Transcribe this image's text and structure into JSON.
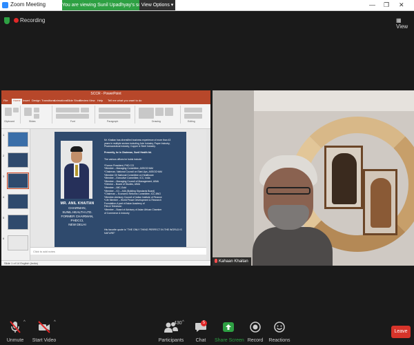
{
  "window": {
    "title": "Zoom Meeting",
    "banner_text": "You are viewing Sunil Upadhyay's screen",
    "view_options_label": "View Options"
  },
  "topbar": {
    "recording_label": "Recording",
    "view_label": "View"
  },
  "shared_screen": {
    "ppt_title": "SCCR - PowerPoint",
    "tabs": [
      "File",
      "Home",
      "Insert",
      "Design",
      "Transitions",
      "Animations",
      "Slide Show",
      "Review",
      "View",
      "Help",
      "Tell me what you want to do"
    ],
    "ribbon_groups": [
      "Clipboard",
      "Slides",
      "Font",
      "Paragraph",
      "Drawing",
      "Editing"
    ],
    "thumbnail_numbers": [
      "1",
      "2",
      "3",
      "4",
      "5",
      "6"
    ],
    "slide": {
      "name": "MR. ANIL KHAITAN",
      "info_lines": [
        "CHAIRMAN,",
        "SUNIL HEALTH LTD.",
        "FORMER CHAIRMAN, PHDCCI,",
        "NEW DELHI"
      ],
      "body_lines": [
        "Mr. Khaitan has diversified business experience of more than 43",
        "years in multiple sectors including Jute Industry, Paper Industry,",
        "Pharmaceutical Industry, Copper & Steel Industry.",
        "",
        "Presently, he is Chairman, Sunil Health ltd.",
        "",
        "The various offices he holds include:",
        "",
        "*Former President, PHD CCI",
        "*Member – Managing Committee, ASSOCHAM",
        "*Chairman- National Council on Start-Ups, ASSOCHAM",
        "*Member CII National Committee on Healthcare",
        "*Member – Executive Committee, ICC, India",
        "*Member – Managing Council of Management, AIMA",
        "*Director – Board of Studies, AIMA",
        "*Member – IMC-Gold",
        "*Member – ICI – AIIA (Building Standards Board)",
        "*Chairman – Economic Reforms Committee, ICC-BNO",
        "*Member-Advisory Council of Indian Institute of Finance",
        "*Life Member – World Peace Development & Research",
        "Foundation-A part of Asian Academy of",
        "Film & Television",
        "*Member – Board of Advisory of Asian African Chamber",
        "of Commerce & Industry"
      ],
      "quote": "His favorite quote is \"THE ONLY THING PERFECT IN THE WORLD IS NATURE\""
    },
    "notes_placeholder": "Click to add notes",
    "status_text": "Slide 1 of 14    English (India)"
  },
  "participant_video": {
    "name": "Kahaan Khaitan"
  },
  "toolbar": {
    "items": [
      {
        "label": "Unmute",
        "icon": "mic-muted-icon"
      },
      {
        "label": "Start Video",
        "icon": "video-off-icon"
      },
      {
        "label": "Participants",
        "icon": "participants-icon",
        "count": "430"
      },
      {
        "label": "Chat",
        "icon": "chat-icon",
        "badge": "5"
      },
      {
        "label": "Share Screen",
        "icon": "share-screen-icon"
      },
      {
        "label": "Record",
        "icon": "record-icon"
      },
      {
        "label": "Reactions",
        "icon": "reactions-icon"
      }
    ],
    "leave_label": "Leave",
    "colors": {
      "muted": "#e02828",
      "share": "#2ea043",
      "leave": "#d7342a",
      "badge": "#e02828"
    }
  }
}
